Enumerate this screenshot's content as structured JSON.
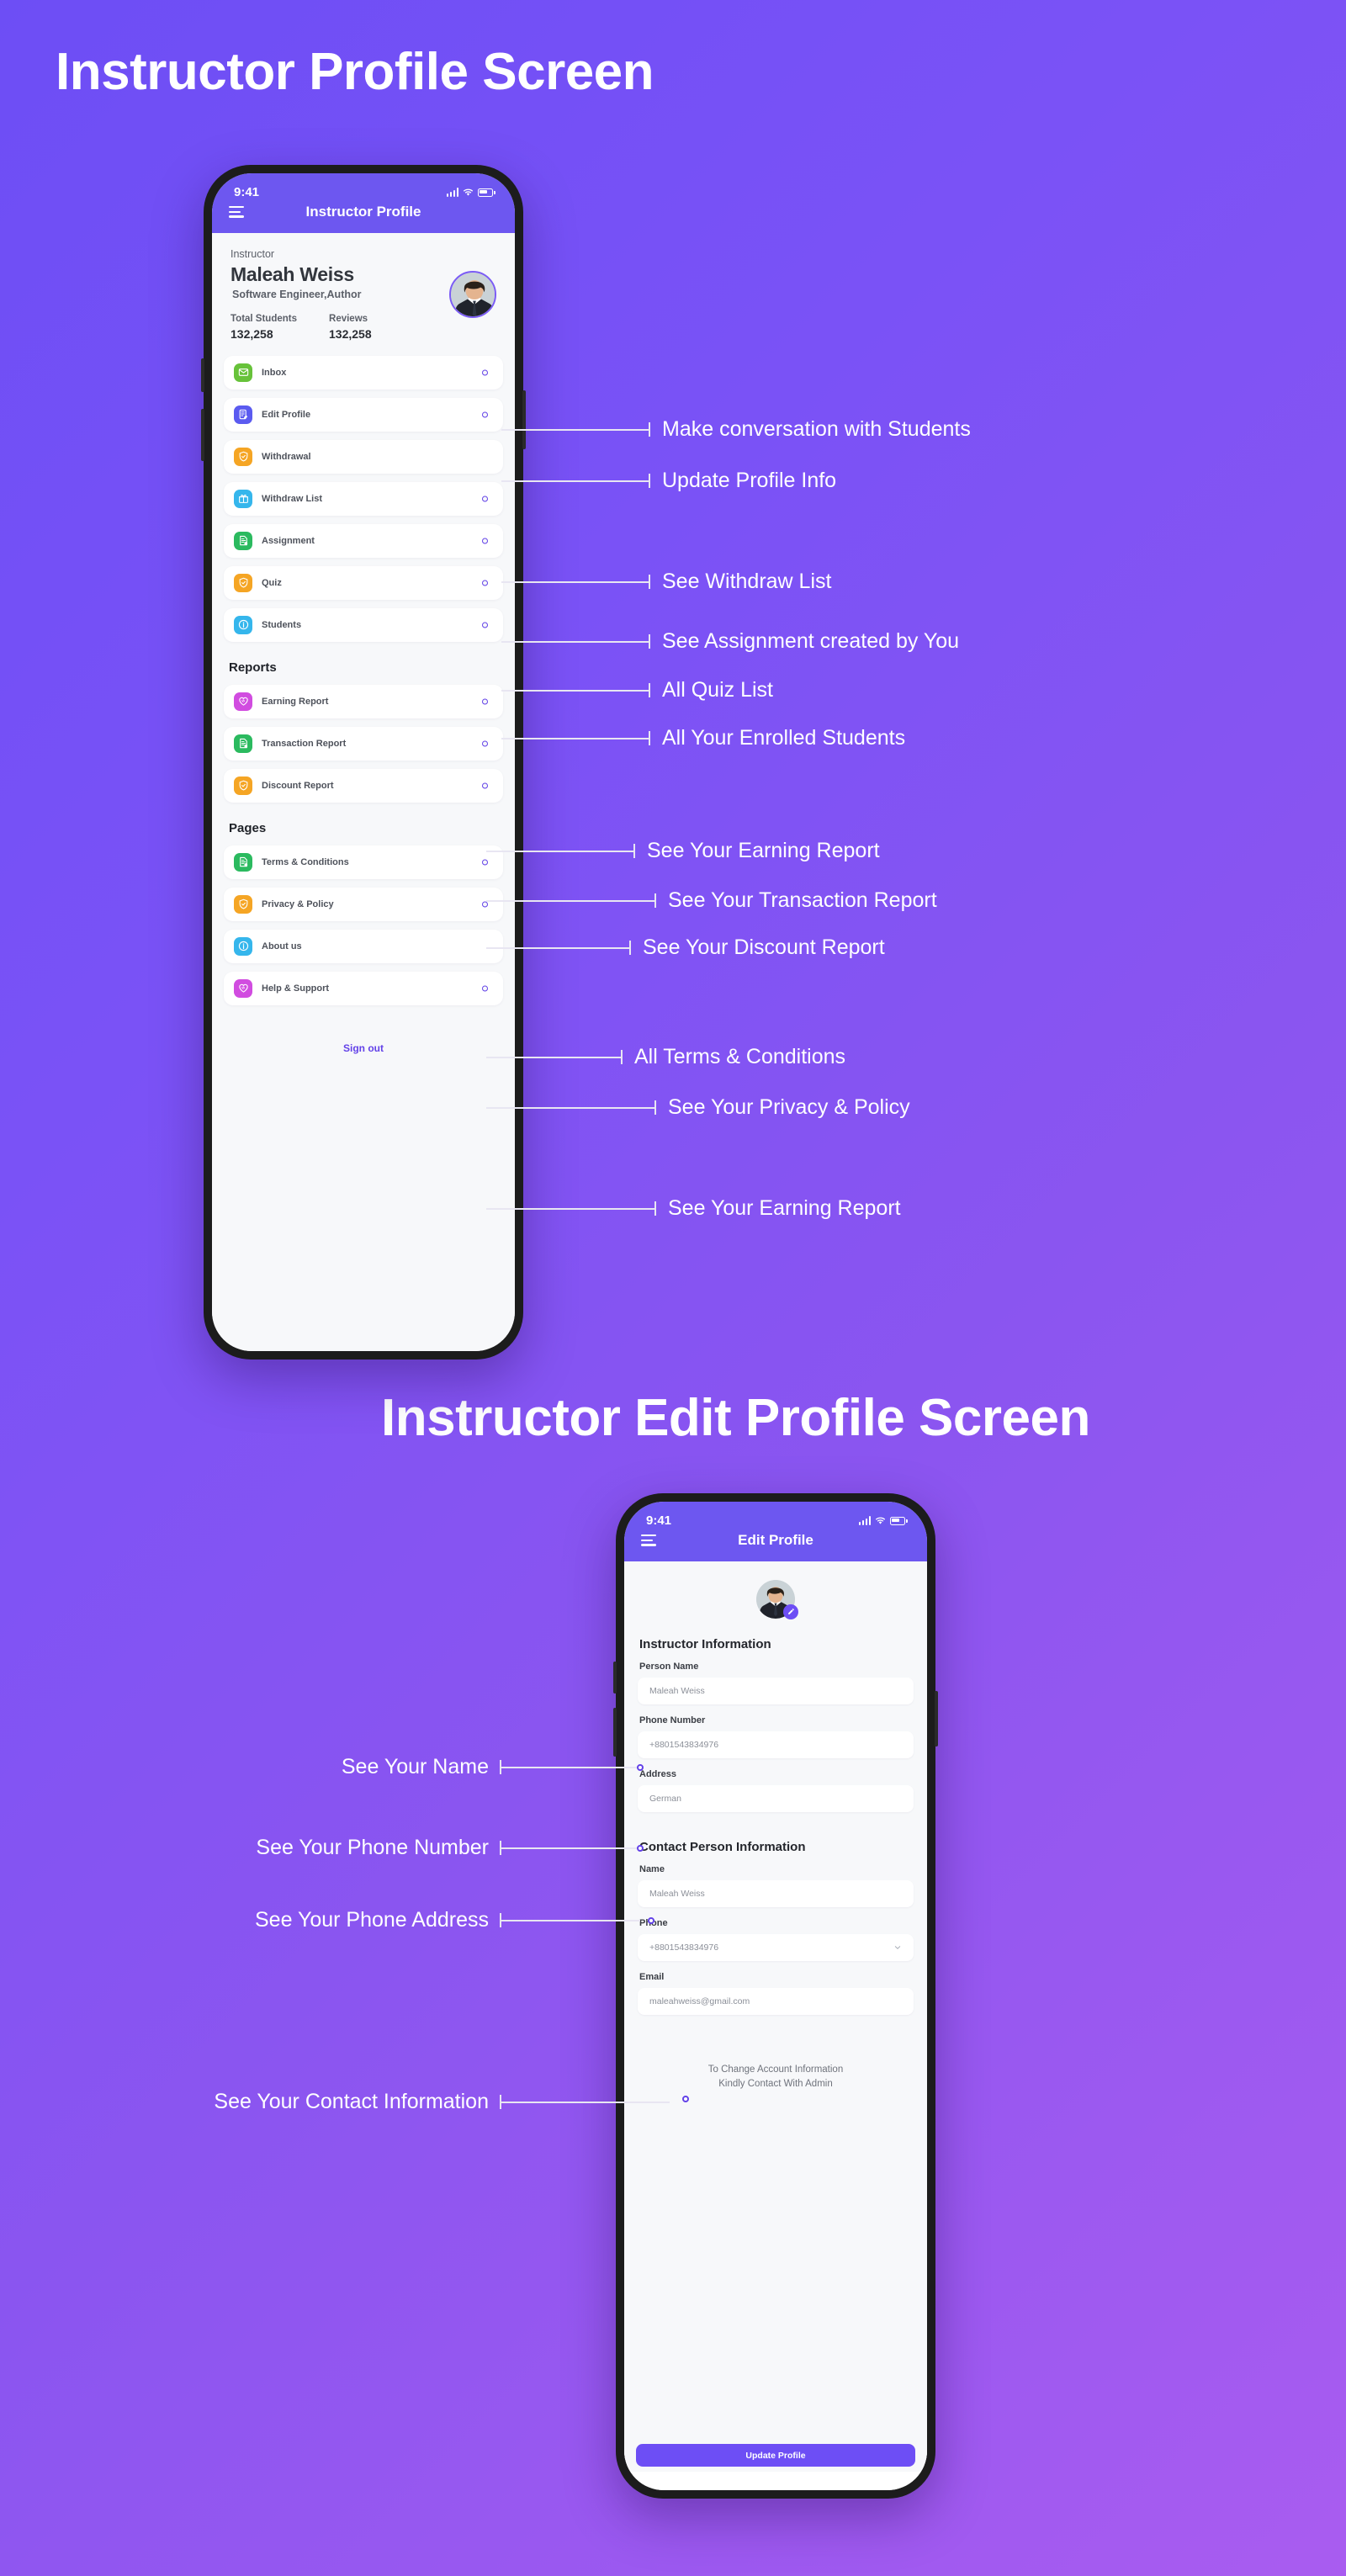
{
  "sections": {
    "profile_title": "Instructor Profile Screen",
    "edit_title": "Instructor Edit Profile Screen"
  },
  "phone1": {
    "status": {
      "time": "9:41"
    },
    "appbar": {
      "title": "Instructor Profile",
      "menu_icon": "hamburger-icon"
    },
    "profile": {
      "role_label": "Instructor",
      "name": "Maleah Weiss",
      "subtitle": "Software Engineer,Author",
      "stats": [
        {
          "label": "Total Students",
          "value": "132,258"
        },
        {
          "label": "Reviews",
          "value": "132,258"
        }
      ]
    },
    "menu": [
      {
        "label": "Inbox",
        "icon": "envelope-icon",
        "color": "#67c23a",
        "dot": true
      },
      {
        "label": "Edit Profile",
        "icon": "edit-doc-icon",
        "color": "#5b5bf0",
        "dot": true
      },
      {
        "label": "Withdrawal",
        "icon": "shield-check-icon",
        "color": "#f5a524",
        "dot": false
      },
      {
        "label": "Withdraw List",
        "icon": "gift-icon",
        "color": "#35b6ec",
        "dot": true
      },
      {
        "label": "Assignment",
        "icon": "doc-check-icon",
        "color": "#2bba5f",
        "dot": true
      },
      {
        "label": "Quiz",
        "icon": "shield-check-icon",
        "color": "#f5a524",
        "dot": true
      },
      {
        "label": "Students",
        "icon": "info-icon",
        "color": "#35b6ec",
        "dot": true
      }
    ],
    "reports_heading": "Reports",
    "reports": [
      {
        "label": "Earning Report",
        "icon": "heart-hands-icon",
        "color": "#d14ce0",
        "dot": true
      },
      {
        "label": "Transaction Report",
        "icon": "doc-check-icon",
        "color": "#2bba5f",
        "dot": true
      },
      {
        "label": "Discount Report",
        "icon": "shield-check-icon",
        "color": "#f5a524",
        "dot": true
      }
    ],
    "pages_heading": "Pages",
    "pages": [
      {
        "label": "Terms & Conditions",
        "icon": "doc-check-icon",
        "color": "#2bba5f",
        "dot": true
      },
      {
        "label": "Privacy & Policy",
        "icon": "shield-check-icon",
        "color": "#f5a524",
        "dot": true
      },
      {
        "label": "About us",
        "icon": "info-icon",
        "color": "#35b6ec",
        "dot": false
      },
      {
        "label": "Help & Support",
        "icon": "heart-hands-icon",
        "color": "#d14ce0",
        "dot": true
      }
    ],
    "signout": "Sign out"
  },
  "annotations_right": [
    "Make conversation with Students",
    "Update Profile Info",
    "See Withdraw List",
    "See Assignment created by You",
    "All Quiz List",
    "All Your Enrolled Students",
    "See Your Earning Report",
    "See Your Transaction Report",
    "See Your Discount Report",
    "All Terms & Conditions",
    "See Your Privacy & Policy",
    "See Your Earning Report"
  ],
  "annotations_left": [
    "See Your Name",
    "See Your Phone Number",
    "See Your Phone Address",
    "See Your Contact Information"
  ],
  "phone2": {
    "status": {
      "time": "9:41"
    },
    "appbar": {
      "title": "Edit Profile",
      "menu_icon": "hamburger-icon"
    },
    "avatar_edit_icon": "pencil-icon",
    "instructor_section": "Instructor Information",
    "instructor_fields": [
      {
        "label": "Person Name",
        "value": "Maleah Weiss",
        "chevron": false
      },
      {
        "label": "Phone Number",
        "value": "+8801543834976",
        "chevron": false
      },
      {
        "label": "Address",
        "value": "German",
        "chevron": false
      }
    ],
    "contact_section": "Contact Person Information",
    "contact_fields": [
      {
        "label": "Name",
        "value": "Maleah Weiss",
        "chevron": false
      },
      {
        "label": "Phone",
        "value": "+8801543834976",
        "chevron": true
      },
      {
        "label": "Email",
        "value": "maleahweiss@gmail.com",
        "chevron": false
      }
    ],
    "admin_note_line1": "To Change Account Information",
    "admin_note_line2": "Kindly Contact With Admin",
    "update_button": "Update Profile"
  },
  "colors": {
    "brand": "#6d4ef5",
    "appbar": "#6d57f0",
    "dot_ring": "#6342e8",
    "anno_line": "#e8e6f2"
  }
}
